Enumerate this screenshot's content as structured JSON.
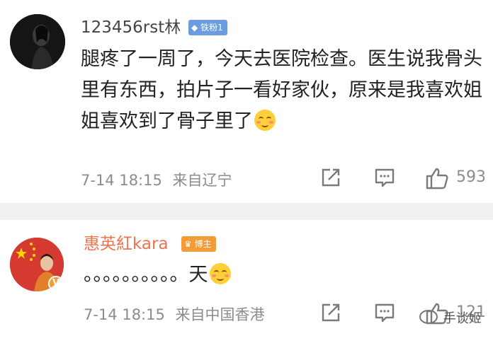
{
  "comments": [
    {
      "username": "123456rst林",
      "badge_label": "铁粉1",
      "badge_color": "#6b9ce0",
      "text": "腿疼了一周了，今天去医院检查。医生说我骨头里有东西，拍片子一看好家伙，原来是我喜欢姐姐喜欢到了骨子里了",
      "emoji": "shy-smile-emoji",
      "time": "7-14 18:15",
      "location": "来自辽宁",
      "likes": "593"
    },
    {
      "username": "惠英紅kara",
      "badge_label": "博主",
      "badge_color": "#f29c38",
      "text": "。。。。。。。。。。天",
      "emoji": "blush-emoji",
      "time": "7-14 18:15",
      "location": "来自中国香港",
      "likes": "121"
    }
  ],
  "watermark": "手谈姬",
  "colors": {
    "vip_name": "#eb7350",
    "divider": "#f1f1f1",
    "meta_text": "#8c8c8c"
  }
}
